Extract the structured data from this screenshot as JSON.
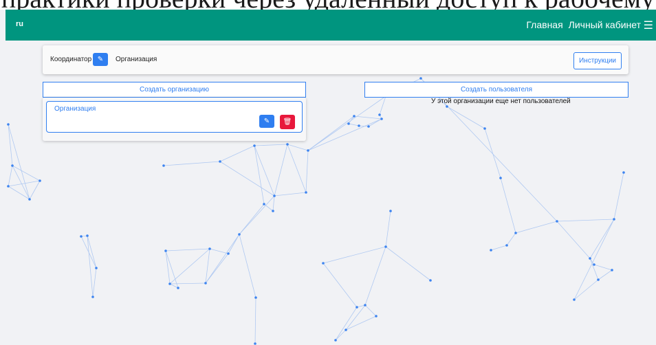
{
  "top_fragment": "практики проверки через удаленный доступ к рабочему",
  "navbar": {
    "brand": "ru",
    "links": [
      "Главная",
      "Личный кабинет"
    ],
    "menu_icon": "hamburger-icon",
    "bg_color": "#00957f"
  },
  "coordinator_bar": {
    "coordinator_label": "Координатор",
    "organization_label": "Организация",
    "instructions_label": "Инструкции",
    "edit_icon": "pencil-icon"
  },
  "left_column": {
    "create_org_label": "Создать организацию",
    "organizations": [
      {
        "name": "Организация"
      }
    ],
    "edit_icon": "pencil-icon",
    "delete_icon": "trash-icon"
  },
  "right_column": {
    "create_user_label": "Создать пользователя",
    "empty_text": "У этой организации еще нет пользователей"
  },
  "colors": {
    "accent": "#2f7ef0",
    "danger": "#e8183b",
    "background": "#f1f2f5"
  }
}
